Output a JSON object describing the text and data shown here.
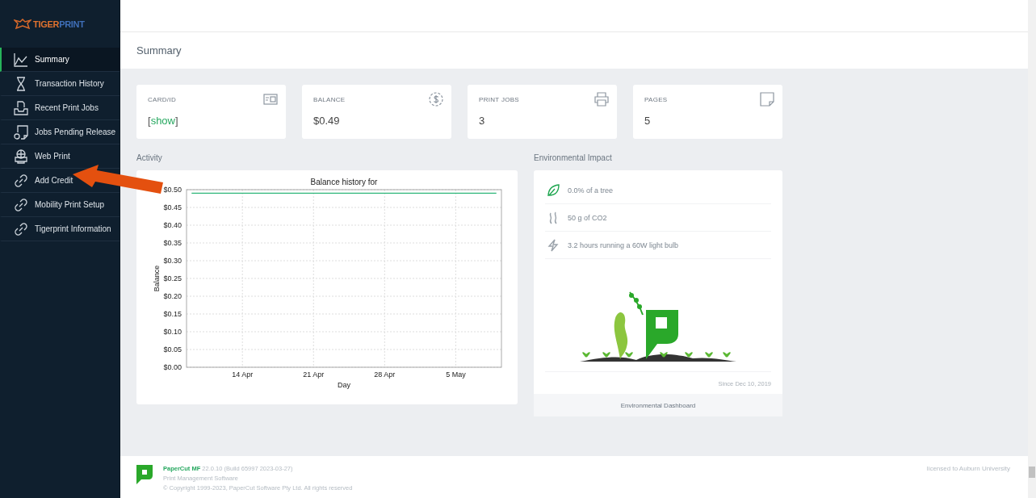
{
  "brand": {
    "name_part1": "TIGER",
    "name_part2": "PRINT"
  },
  "sidebar": {
    "items": [
      {
        "label": "Summary",
        "selected": true
      },
      {
        "label": "Transaction History",
        "selected": false
      },
      {
        "label": "Recent Print Jobs",
        "selected": false
      },
      {
        "label": "Jobs Pending Release",
        "selected": false
      },
      {
        "label": "Web Print",
        "selected": false
      },
      {
        "label": "Add Credit",
        "selected": false
      },
      {
        "label": "Mobility Print Setup",
        "selected": false
      },
      {
        "label": "Tigerprint Information",
        "selected": false
      }
    ]
  },
  "page_title": "Summary",
  "stats": [
    {
      "label": "CARD/ID",
      "kind": "link",
      "prefix": "[",
      "value": "show",
      "suffix": "]"
    },
    {
      "label": "BALANCE",
      "kind": "text",
      "value": "$0.49"
    },
    {
      "label": "PRINT JOBS",
      "kind": "text",
      "value": "3"
    },
    {
      "label": "PAGES",
      "kind": "text",
      "value": "5"
    }
  ],
  "activity": {
    "heading": "Activity",
    "chart_data": {
      "type": "line",
      "title": "Balance history for",
      "xlabel": "Day",
      "ylabel": "Balance",
      "categories": [
        null,
        null,
        null,
        null,
        null,
        "14 Apr",
        null,
        null,
        null,
        null,
        null,
        null,
        "21 Apr",
        null,
        null,
        null,
        null,
        null,
        null,
        "28 Apr",
        null,
        null,
        null,
        null,
        null,
        null,
        "5 May",
        null,
        null,
        null,
        null
      ],
      "series": [
        {
          "color": "#2fb67a",
          "values": [
            0.49,
            0.49,
            0.49,
            0.49,
            0.49,
            0.49,
            0.49,
            0.49,
            0.49,
            0.49,
            0.49,
            0.49,
            0.49,
            0.49,
            0.49,
            0.49,
            0.49,
            0.49,
            0.49,
            0.49,
            0.49,
            0.49,
            0.49,
            0.49,
            0.49,
            0.49,
            0.49,
            0.49,
            0.49,
            0.49,
            0.49
          ]
        }
      ],
      "ylim": [
        0,
        0.5
      ],
      "grid": true,
      "yticks": [
        {
          "value": 0,
          "label": "$0.00"
        },
        {
          "value": 0.05,
          "label": "$0.05"
        },
        {
          "value": 0.1,
          "label": "$0.10"
        },
        {
          "value": 0.15,
          "label": "$0.15"
        },
        {
          "value": 0.2,
          "label": "$0.20"
        },
        {
          "value": 0.25,
          "label": "$0.25"
        },
        {
          "value": 0.3,
          "label": "$0.30"
        },
        {
          "value": 0.35,
          "label": "$0.35"
        },
        {
          "value": 0.4,
          "label": "$0.40"
        },
        {
          "value": 0.45,
          "label": "$0.45"
        },
        {
          "value": 0.5,
          "label": "$0.50"
        }
      ]
    }
  },
  "environment": {
    "heading": "Environmental Impact",
    "items": [
      {
        "text": "0.0% of a tree"
      },
      {
        "text": "50 g of CO2"
      },
      {
        "text": "3.2 hours running a 60W light bulb"
      }
    ],
    "since": "Since Dec 10, 2019",
    "link": "Environmental Dashboard"
  },
  "footer": {
    "product": "PaperCut MF",
    "version": "22.0.10 (Build 65997 2023-03-27)",
    "subtitle": "Print Management Software",
    "copyright": "© Copyright 1999-2023, PaperCut Software Pty Ltd. All rights reserved",
    "license": "licensed to Auburn University"
  }
}
